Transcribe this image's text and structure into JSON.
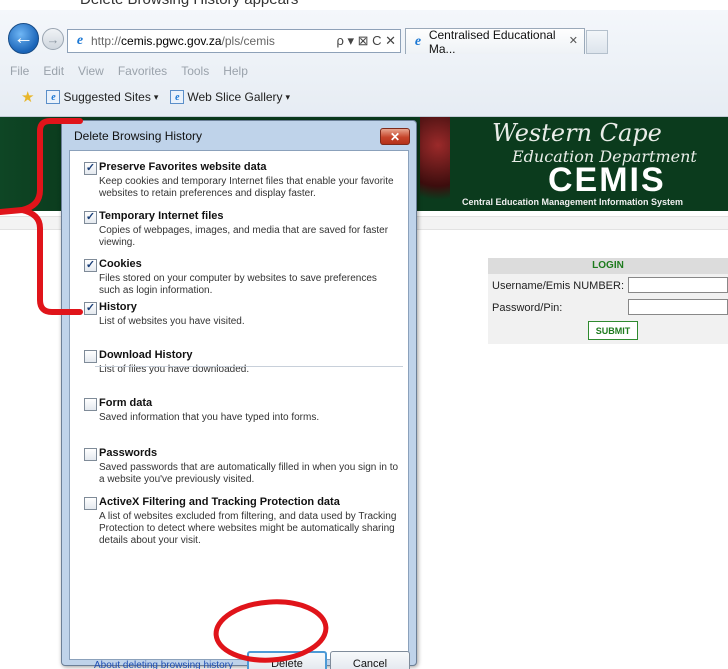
{
  "caption": "Delete Browsing History appears",
  "browser": {
    "url_proto": "http://",
    "url_host": "cemis.pgwc.gov.za",
    "url_path": "/pls/cemis",
    "addr_icons": "ρ ▾ ⊠ C ✕",
    "tab_title": "Centralised Educational Ma...",
    "tab_close": "✕",
    "menu": [
      "File",
      "Edit",
      "View",
      "Favorites",
      "Tools",
      "Help"
    ],
    "favorites": [
      {
        "label": "Suggested Sites",
        "caret": "▾"
      },
      {
        "label": "Web Slice Gallery",
        "caret": "▾"
      }
    ],
    "back_glyph": "←",
    "fwd_glyph": "→",
    "ie_glyph": "e"
  },
  "site": {
    "title1": "Western Cape",
    "title2": "Education Department",
    "title3": "CEMIS",
    "subtitle": "Central Education Management Information System",
    "login_header": "LOGIN",
    "username_label": "Username/Emis NUMBER:",
    "password_label": "Password/Pin:",
    "submit_label": "SUBMIT"
  },
  "dialog": {
    "title": "Delete Browsing History",
    "close_glyph": "✕",
    "options": [
      {
        "title": "Preserve Favorites website data",
        "checked": true,
        "desc": "Keep cookies and temporary Internet files that enable your favorite websites to retain preferences and display faster."
      },
      {
        "title": "Temporary Internet files",
        "checked": true,
        "desc": "Copies of webpages, images, and media that are saved for faster viewing."
      },
      {
        "title": "Cookies",
        "checked": true,
        "desc": "Files stored on your computer by websites to save preferences such as login information."
      },
      {
        "title": "History",
        "checked": true,
        "desc": "List of websites you have visited."
      },
      {
        "title": "Download History",
        "checked": false,
        "desc": "List of files you have downloaded."
      },
      {
        "title": "Form data",
        "checked": false,
        "desc": "Saved information that you have typed into forms."
      },
      {
        "title": "Passwords",
        "checked": false,
        "desc": "Saved passwords that are automatically filled in when you sign in to a website you've previously visited."
      },
      {
        "title": "ActiveX Filtering and Tracking Protection data",
        "checked": false,
        "desc": "A list of websites excluded from filtering, and data used by Tracking Protection to detect where websites might be automatically sharing details about your visit."
      }
    ],
    "link_text": "About deleting browsing history",
    "delete_label": "Delete",
    "cancel_label": "Cancel",
    "check_glyph": "✓"
  },
  "annotation": {
    "color": "#e0141a"
  }
}
